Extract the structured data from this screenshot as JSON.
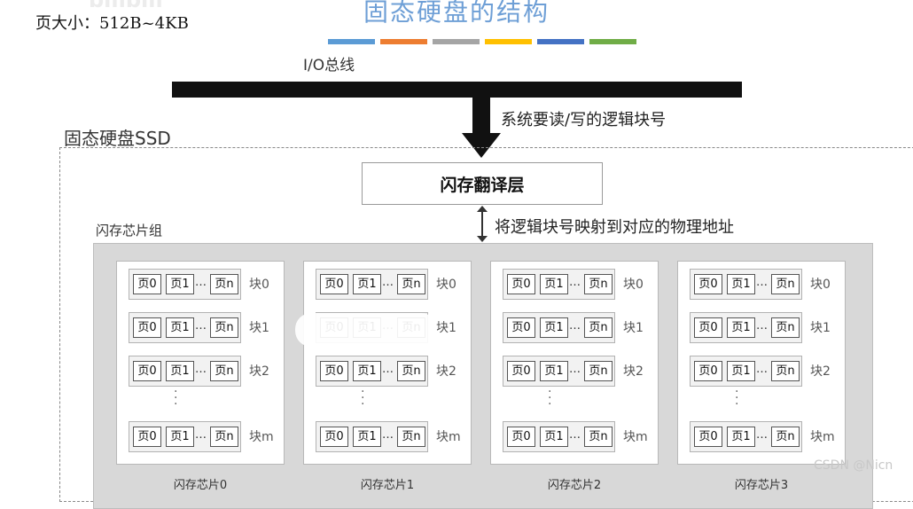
{
  "note": "页大小：512B~4KB",
  "title": "固态硬盘的结构",
  "color_strip": [
    "#5b9bd5",
    "#ed7d31",
    "#a5a5a5",
    "#ffc000",
    "#4472c4",
    "#70ad47"
  ],
  "io_bus_label": "I/O总线",
  "request_label": "系统要读/写的逻辑块号",
  "ssd_label": "固态硬盘SSD",
  "ftl_label": "闪存翻译层",
  "mapping_label": "将逻辑块号映射到对应的物理地址",
  "chip_group_label": "闪存芯片组",
  "page_labels": {
    "p0": "页0",
    "p1": "页1",
    "pn": "页n",
    "ellipsis": "…"
  },
  "block_labels": {
    "b0": "块0",
    "b1": "块1",
    "b2": "块2",
    "bm": "块m"
  },
  "vertical_ellipsis": "⋮",
  "chips": [
    {
      "name": "闪存芯片0"
    },
    {
      "name": "闪存芯片1"
    },
    {
      "name": "闪存芯片2"
    },
    {
      "name": "闪存芯片3"
    }
  ],
  "marked_pages_colors": [
    "#e01010",
    "#000000",
    "#000000"
  ],
  "watermark": "CSDN @Nicn"
}
